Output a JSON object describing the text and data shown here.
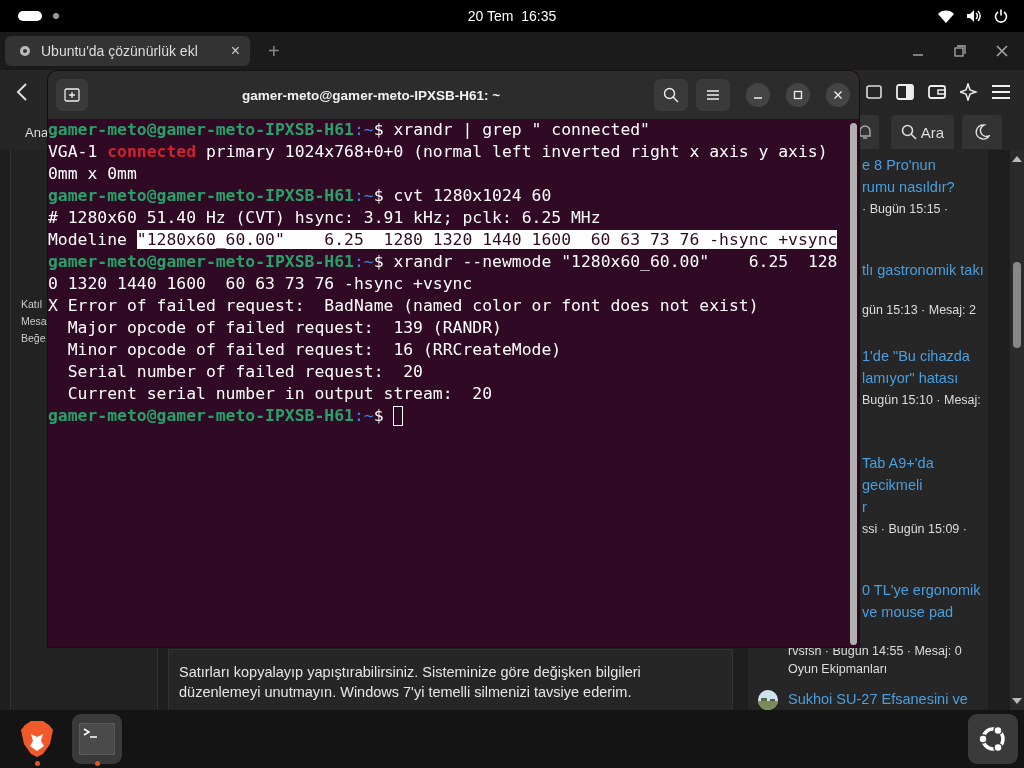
{
  "top_bar": {
    "clock": "20 Tem  16:35"
  },
  "browser": {
    "tab": {
      "title": "Ubuntu'da çözünürlük ekl",
      "close": "×",
      "selected": true
    },
    "new_tab": "+",
    "page": {
      "header": {
        "nav_label": "Ana",
        "search_button": "Ara"
      },
      "left_sidebar": {
        "labels": [
          "Katıl",
          "Mesa",
          "Beğe"
        ]
      },
      "post_text": "Satırları kopyalayıp yapıştırabilirsiniz. Sisteminize göre değişken bilgileri düzenlemeyi unutmayın. Windows 7'yi temelli silmenizi tavsiye ederim.",
      "right_sidebar": {
        "items": [
          {
            "lines": [
              {
                "kind": "link",
                "text": "e 8 Pro'nun"
              },
              {
                "kind": "link",
                "text": "rumu nasıldır?"
              },
              {
                "kind": "meta",
                "text": "· Bugün 15:15 ·"
              }
            ]
          },
          {
            "lines": [
              {
                "kind": "link",
                "text": "tlı gastronomik takı"
              },
              {
                "kind": "meta",
                "text": "gün 15:13 · Mesaj: 2"
              }
            ]
          },
          {
            "lines": [
              {
                "kind": "link",
                "text": "1'de \"Bu cihazda"
              },
              {
                "kind": "link",
                "text": "lamıyor\" hatası"
              },
              {
                "kind": "meta",
                "text": "Bugün 15:10 · Mesaj:"
              }
            ]
          },
          {
            "lines": [
              {
                "kind": "link",
                "text": "Tab A9+'da"
              },
              {
                "kind": "link",
                "text": "gecikmeli"
              },
              {
                "kind": "link",
                "text": "r"
              },
              {
                "kind": "meta",
                "text": "ssi · Bugün 15:09 ·"
              }
            ]
          },
          {
            "lines": [
              {
                "kind": "link",
                "text": "0 TL'ye ergonomik"
              },
              {
                "kind": "link",
                "text": "ve mouse pad"
              },
              {
                "kind": "meta",
                "text": "rvsfsh · Bugün 14:55 · Mesaj: 0"
              },
              {
                "kind": "category",
                "text": "Oyun Ekipmanları"
              }
            ]
          },
          {
            "avatar": {
              "kind": "picture"
            },
            "lines": [
              {
                "kind": "link",
                "text": "Sukhoi SU-27 Efsanesini ve"
              }
            ]
          }
        ]
      }
    }
  },
  "terminal": {
    "title": "gamer-meto@gamer-meto-IPXSB-H61: ~",
    "lines": [
      {
        "kind": "prompt",
        "user": "gamer-meto@gamer-meto-IPXSB-H61",
        "path": ":~",
        "sign": "$",
        "command": "xrandr | grep \" connected\"",
        "cursor": false
      },
      {
        "kind": "output",
        "segments": [
          {
            "text": "VGA-1 ",
            "kind": "plain"
          },
          {
            "text": "connected",
            "kind": "error"
          },
          {
            "text": " primary 1024x768+0+0 (normal left inverted right x axis y axis)",
            "kind": "plain"
          }
        ]
      },
      {
        "kind": "output",
        "segments": [
          {
            "text": "0mm x 0mm",
            "kind": "plain"
          }
        ]
      },
      {
        "kind": "prompt",
        "user": "gamer-meto@gamer-meto-IPXSB-H61",
        "path": ":~",
        "sign": "$",
        "command": "cvt 1280x1024 60",
        "cursor": false
      },
      {
        "kind": "output",
        "segments": [
          {
            "text": "# 1280x60 51.40 Hz (CVT) hsync: 3.91 kHz; pclk: 6.25 MHz",
            "kind": "plain"
          }
        ]
      },
      {
        "kind": "output",
        "segments": [
          {
            "text": "Modeline ",
            "kind": "plain"
          },
          {
            "text": "\"1280x60_60.00\"    6.25  1280 1320 1440 1600  60 63 73 76 -hsync +vsync",
            "kind": "selected"
          }
        ]
      },
      {
        "kind": "prompt",
        "user": "gamer-meto@gamer-meto-IPXSB-H61",
        "path": ":~",
        "sign": "$",
        "command": "xrandr --newmode \"1280x60_60.00\"    6.25  128",
        "cursor": false
      },
      {
        "kind": "output",
        "segments": [
          {
            "text": "0 1320 1440 1600  60 63 73 76 -hsync +vsync",
            "kind": "plain"
          }
        ]
      },
      {
        "kind": "output",
        "segments": [
          {
            "text": "X Error of failed request:  BadName (named color or font does not exist)",
            "kind": "plain"
          }
        ]
      },
      {
        "kind": "output",
        "segments": [
          {
            "text": "  Major opcode of failed request:  139 (RANDR)",
            "kind": "plain"
          }
        ]
      },
      {
        "kind": "output",
        "segments": [
          {
            "text": "  Minor opcode of failed request:  16 (RRCreateMode)",
            "kind": "plain"
          }
        ]
      },
      {
        "kind": "output",
        "segments": [
          {
            "text": "  Serial number of failed request:  20",
            "kind": "plain"
          }
        ]
      },
      {
        "kind": "output",
        "segments": [
          {
            "text": "  Current serial number in output stream:  20",
            "kind": "plain"
          }
        ]
      },
      {
        "kind": "prompt",
        "user": "gamer-meto@gamer-meto-IPXSB-H61",
        "path": ":~",
        "sign": "$",
        "cursor": true
      }
    ]
  },
  "dock": {
    "apps": [
      {
        "kind": "brave",
        "running": true,
        "selected": false
      },
      {
        "kind": "terminal",
        "running": true,
        "selected": true
      }
    ]
  }
}
